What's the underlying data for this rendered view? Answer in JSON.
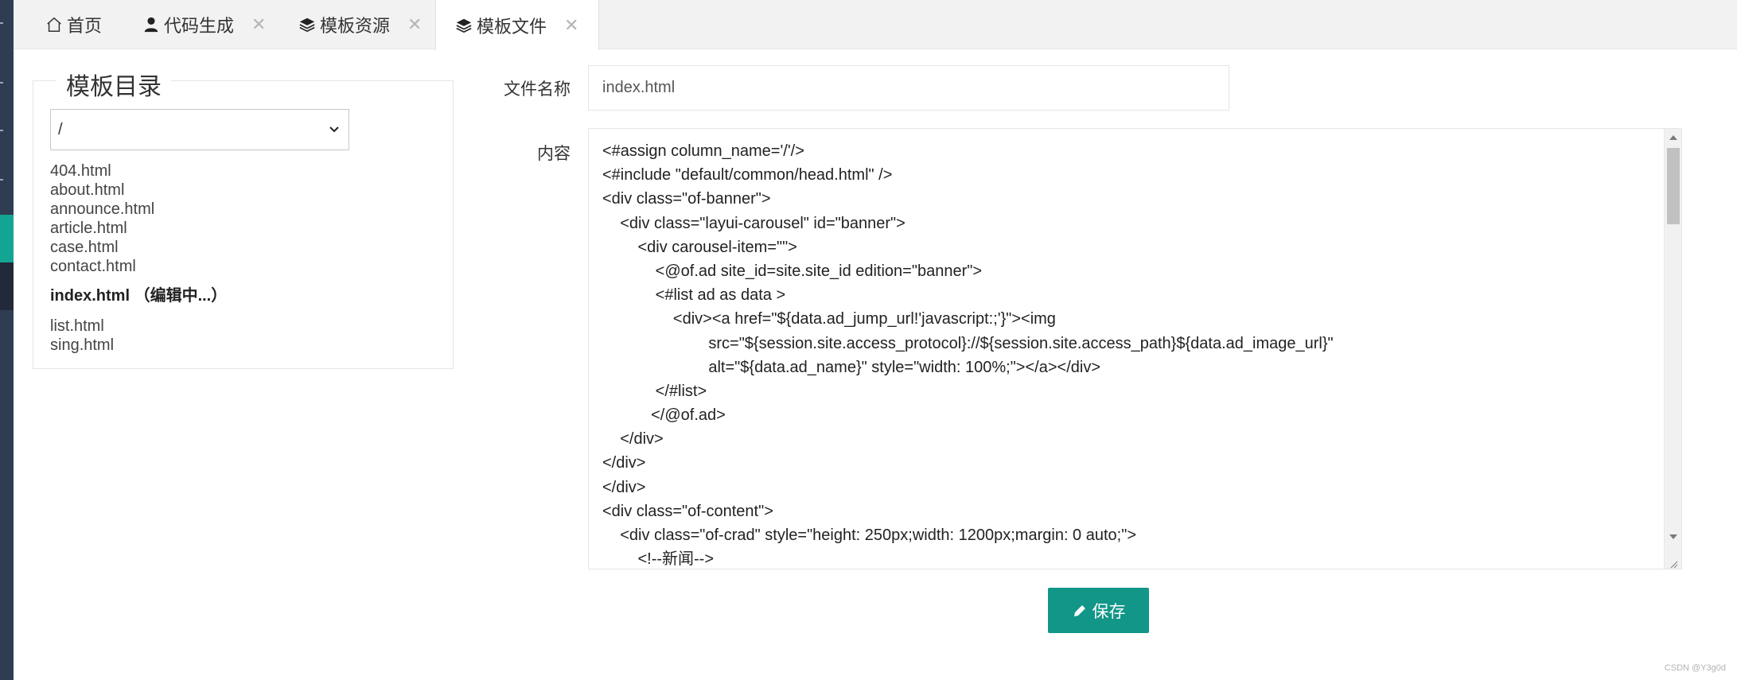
{
  "tabs": [
    {
      "label": "首页",
      "icon": "home-icon",
      "closable": false,
      "active": false
    },
    {
      "label": "代码生成",
      "icon": "user-icon",
      "closable": true,
      "active": false
    },
    {
      "label": "模板资源",
      "icon": "layers-icon",
      "closable": true,
      "active": false
    },
    {
      "label": "模板文件",
      "icon": "layers-icon",
      "closable": true,
      "active": true
    }
  ],
  "close_symbol": "✕",
  "directory": {
    "title": "模板目录",
    "selected": "/",
    "files_before": [
      "404.html",
      "about.html",
      "announce.html",
      "article.html",
      "case.html",
      "contact.html"
    ],
    "editing_file": "index.html （编辑中...）",
    "files_after": [
      "list.html",
      "sing.html"
    ]
  },
  "form": {
    "name_label": "文件名称",
    "name_value": "index.html",
    "content_label": "内容",
    "content_lines": [
      "<#assign column_name='/'/>",
      "<#include \"default/common/head.html\" />",
      "<div class=\"of-banner\">",
      "    <div class=\"layui-carousel\" id=\"banner\">",
      "        <div carousel-item=\"\">",
      "            <@of.ad site_id=site.site_id edition=\"banner\">",
      "            <#list ad as data >",
      "                <div><a href=\"${data.ad_jump_url!'javascript:;'}\"><img",
      "                        src=\"${session.site.access_protocol}://${session.site.access_path}${data.ad_image_url}\"",
      "                        alt=\"${data.ad_name}\" style=\"width: 100%;\"></a></div>",
      "            </#list>",
      "           </@of.ad>",
      "    </div>",
      "</div>",
      "</div>",
      "<div class=\"of-content\">",
      "    <div class=\"of-crad\" style=\"height: 250px;width: 1200px;margin: 0 auto;\">",
      "        <!--新闻-->"
    ],
    "save_label": "保存"
  },
  "watermark": "CSDN @Y3g0d",
  "colors": {
    "accent": "#119688",
    "sidebar": "#2f3d52",
    "sidebar_active": "#13a594"
  }
}
